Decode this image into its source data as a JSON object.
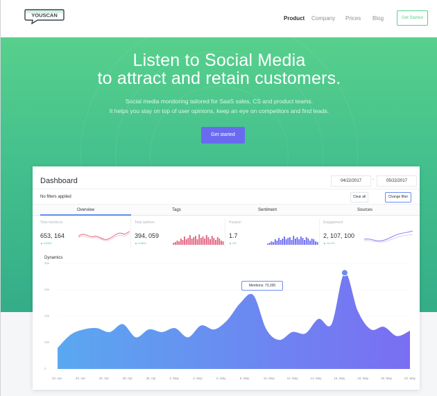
{
  "header": {
    "logo_text": "YOUSCAN",
    "nav": [
      "Product",
      "Company",
      "Prices",
      "Blog"
    ],
    "cta": "Get Started"
  },
  "hero": {
    "title_line1": "Listen to Social Media",
    "title_line2": "to attract and retain customers.",
    "subtitle_line1": "Social media monitoring tailored for SaaS sales, CS and product teams.",
    "subtitle_line2": "It helps you stay on top of user opinions, keep an eye on competitors and find leads.",
    "button": "Get started"
  },
  "dashboard": {
    "title": "Dashboard",
    "date_from": "04/22/2017",
    "date_sep": "-",
    "date_to": "05/22/2017",
    "filters_label": "No filters applied",
    "clear_button": "Clear all",
    "change_button": "Change filter",
    "tabs": [
      "Overview",
      "Tags",
      "Sentiment",
      "Sources"
    ],
    "metrics": [
      {
        "label": "Total mentions",
        "value": "653, 164",
        "delta": "▲ 3.56%",
        "color": "#e0637f"
      },
      {
        "label": "Total authors",
        "value": "394, 059",
        "delta": "▲ 3.56%",
        "color": "#e0637f"
      },
      {
        "label": "Passion",
        "value": "1.7",
        "delta": "▲ 4%",
        "color": "#6a6af0"
      },
      {
        "label": "Engagement",
        "value": "2, 107, 100",
        "delta": "▲ 14.1%",
        "color": "#8a7ff0"
      }
    ],
    "chart_title": "Dynamics",
    "tooltip": "Mentions: 73,330"
  },
  "chart_data": {
    "type": "area",
    "title": "Dynamics",
    "y_ticks": [
      "80k",
      "60k",
      "40k",
      "20k",
      "0"
    ],
    "ylim": [
      0,
      80000
    ],
    "x": [
      "22. Apr",
      "24. Apr",
      "26. Apr",
      "28. Apr",
      "30. Apr",
      "2. May",
      "4. May",
      "6. May",
      "8. May",
      "10. May",
      "12. May",
      "14. May",
      "16. May",
      "18. May",
      "20. May",
      "22. May"
    ],
    "values": [
      16000,
      26000,
      30000,
      31000,
      28000,
      34000,
      24000,
      30000,
      28000,
      31000,
      24000,
      33000,
      30000,
      37000,
      50000,
      56000,
      30000,
      22000,
      28000,
      27000,
      38000,
      34000,
      73000,
      44000,
      30000,
      32000,
      25000,
      29000
    ],
    "tooltip_value": 73330,
    "colors": {
      "start": "#5aa8f0",
      "end": "#7a6ef2"
    },
    "grid": true
  }
}
